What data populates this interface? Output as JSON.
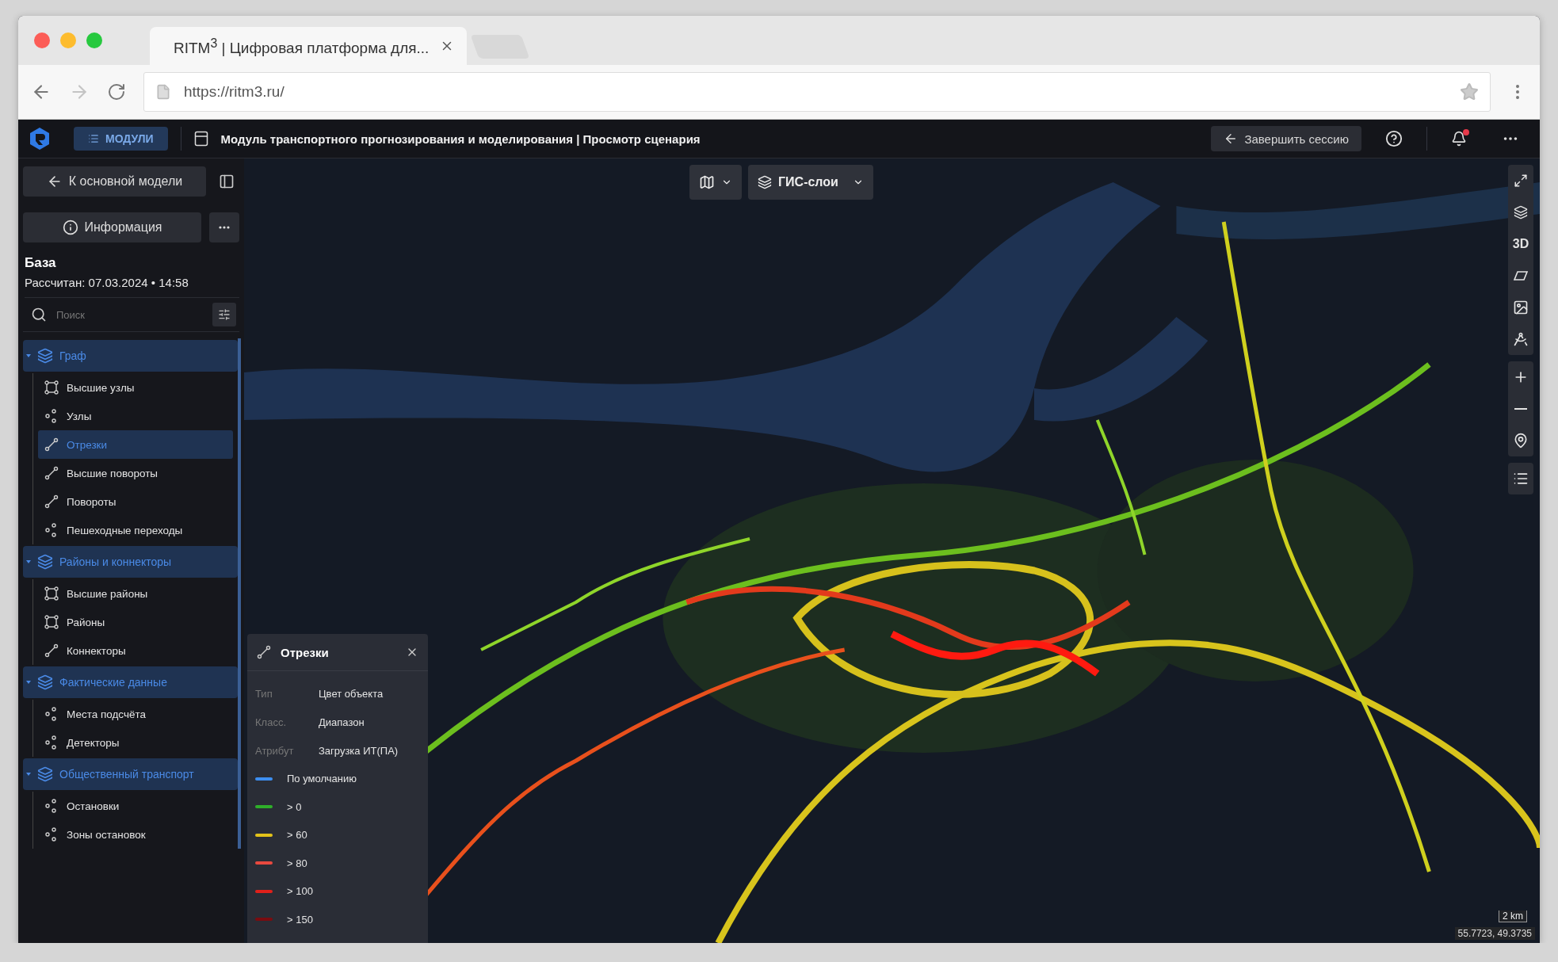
{
  "browser": {
    "tab_title": "RITM$^{3}$ | Цифровая платформа для...",
    "url": "https://ritm3.ru/"
  },
  "header": {
    "modules_button": "МОДУЛИ",
    "title": "Модуль транспортного прогнозирования и моделирования | Просмотр сценария",
    "end_session_button": "Завершить сессию",
    "unread_notifications": true
  },
  "sidebar": {
    "back_button": "К основной модели",
    "info_button": "Информация",
    "scenario_name": "База",
    "calculated": "Рассчитан: 07.03.2024 • 14:58",
    "search": {
      "placeholder": "Поиск"
    },
    "tree": [
      {
        "label": "Граф",
        "expanded": true,
        "children": [
          {
            "label": "Высшие узлы",
            "kind": "area",
            "selected": false
          },
          {
            "label": "Узлы",
            "kind": "points",
            "selected": false
          },
          {
            "label": "Отрезки",
            "kind": "segment",
            "selected": true
          },
          {
            "label": "Высшие повороты",
            "kind": "segment",
            "selected": false
          },
          {
            "label": "Повороты",
            "kind": "segment",
            "selected": false
          },
          {
            "label": "Пешеходные переходы",
            "kind": "points",
            "selected": false
          }
        ]
      },
      {
        "label": "Районы и коннекторы",
        "expanded": true,
        "children": [
          {
            "label": "Высшие районы",
            "kind": "area",
            "selected": false
          },
          {
            "label": "Районы",
            "kind": "area",
            "selected": false
          },
          {
            "label": "Коннекторы",
            "kind": "segment",
            "selected": false
          }
        ]
      },
      {
        "label": "Фактические данные",
        "expanded": true,
        "children": [
          {
            "label": "Места подсчёта",
            "kind": "points",
            "selected": false
          },
          {
            "label": "Детекторы",
            "kind": "points",
            "selected": false
          }
        ]
      },
      {
        "label": "Общественный транспорт",
        "expanded": true,
        "children": [
          {
            "label": "Остановки",
            "kind": "points",
            "selected": false
          },
          {
            "label": "Зоны остановок",
            "kind": "points",
            "selected": false
          }
        ]
      }
    ]
  },
  "map": {
    "gis_layers_button": "ГИС-слои",
    "three_d_button": "3D",
    "legend": {
      "title": "Отрезки",
      "attributes": [
        {
          "label": "Тип",
          "value": "Цвет объекта"
        },
        {
          "label": "Класс.",
          "value": "Диапазон"
        },
        {
          "label": "Атрибут",
          "value": "Загрузка ИТ(ПА)"
        }
      ],
      "entries": [
        {
          "label": "По умолчанию",
          "color": "#3d8ef0"
        },
        {
          "label": "> 0",
          "color": "#2fae2a"
        },
        {
          "label": "> 60",
          "color": "#e3c21a"
        },
        {
          "label": "> 80",
          "color": "#e8493f"
        },
        {
          "label": "> 100",
          "color": "#e0201a"
        },
        {
          "label": "> 150",
          "color": "#7a0c10"
        }
      ]
    },
    "scale": "2 km",
    "coordinates": "55.7723, 49.3735"
  }
}
